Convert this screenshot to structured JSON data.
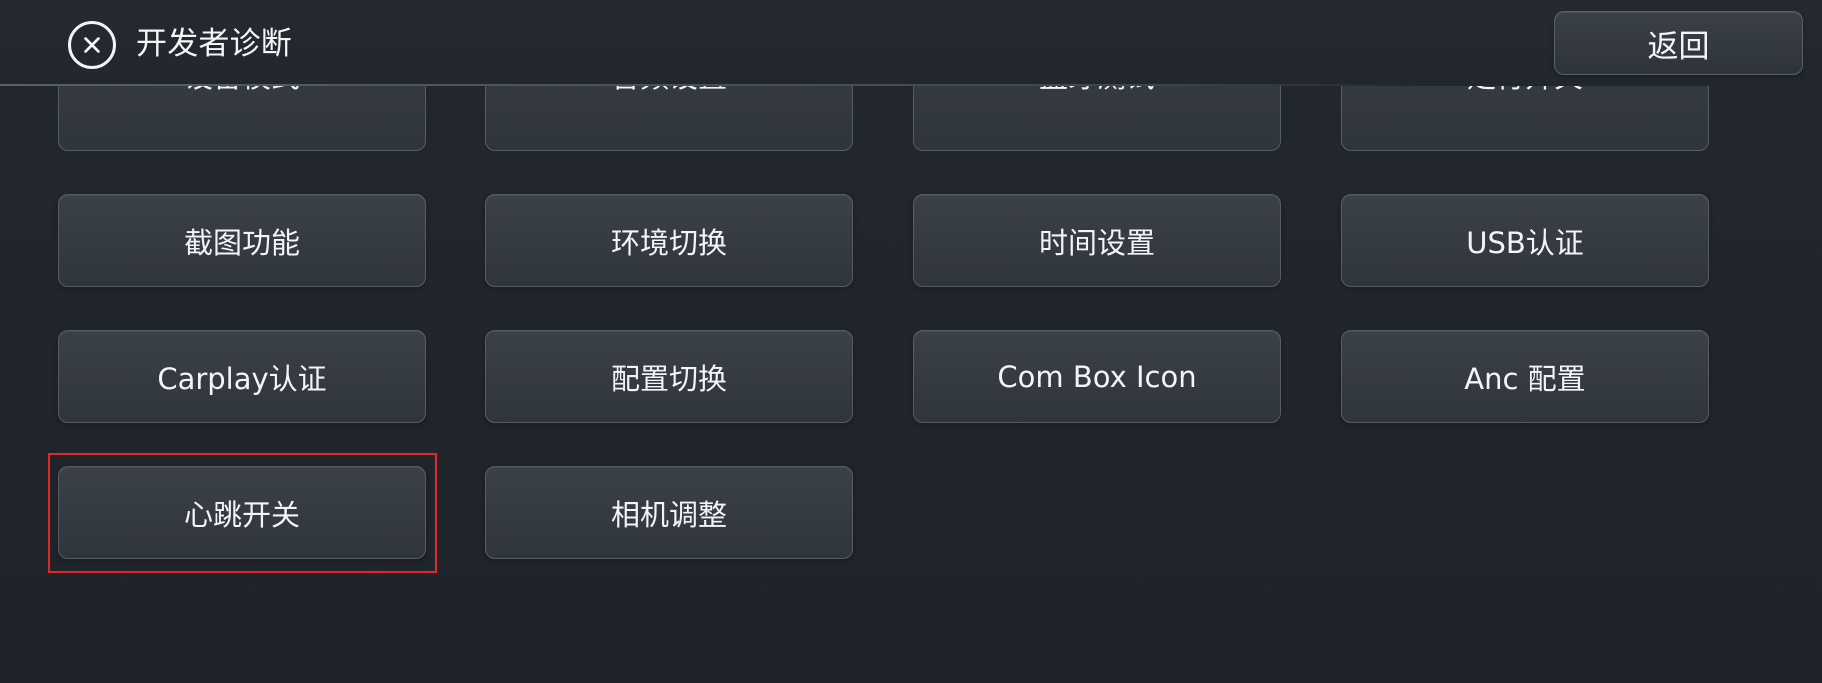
{
  "header": {
    "title": "开发者诊断",
    "back_label": "返回"
  },
  "grid": {
    "partial_top": [
      {
        "label": "设备模式"
      },
      {
        "label": "音频设置"
      },
      {
        "label": "蓝牙测试"
      },
      {
        "label": "走行开关"
      }
    ],
    "row1": [
      {
        "label": "截图功能"
      },
      {
        "label": "环境切换"
      },
      {
        "label": "时间设置"
      },
      {
        "label": "USB认证"
      }
    ],
    "row2": [
      {
        "label": "Carplay认证"
      },
      {
        "label": "配置切换"
      },
      {
        "label": "Com Box Icon"
      },
      {
        "label": "Anc 配置"
      }
    ],
    "row3": [
      {
        "label": "心跳开关"
      },
      {
        "label": "相机调整"
      }
    ]
  },
  "colors": {
    "selection_border": "#e2272b",
    "background": "#23272e",
    "button": "#353a42"
  }
}
